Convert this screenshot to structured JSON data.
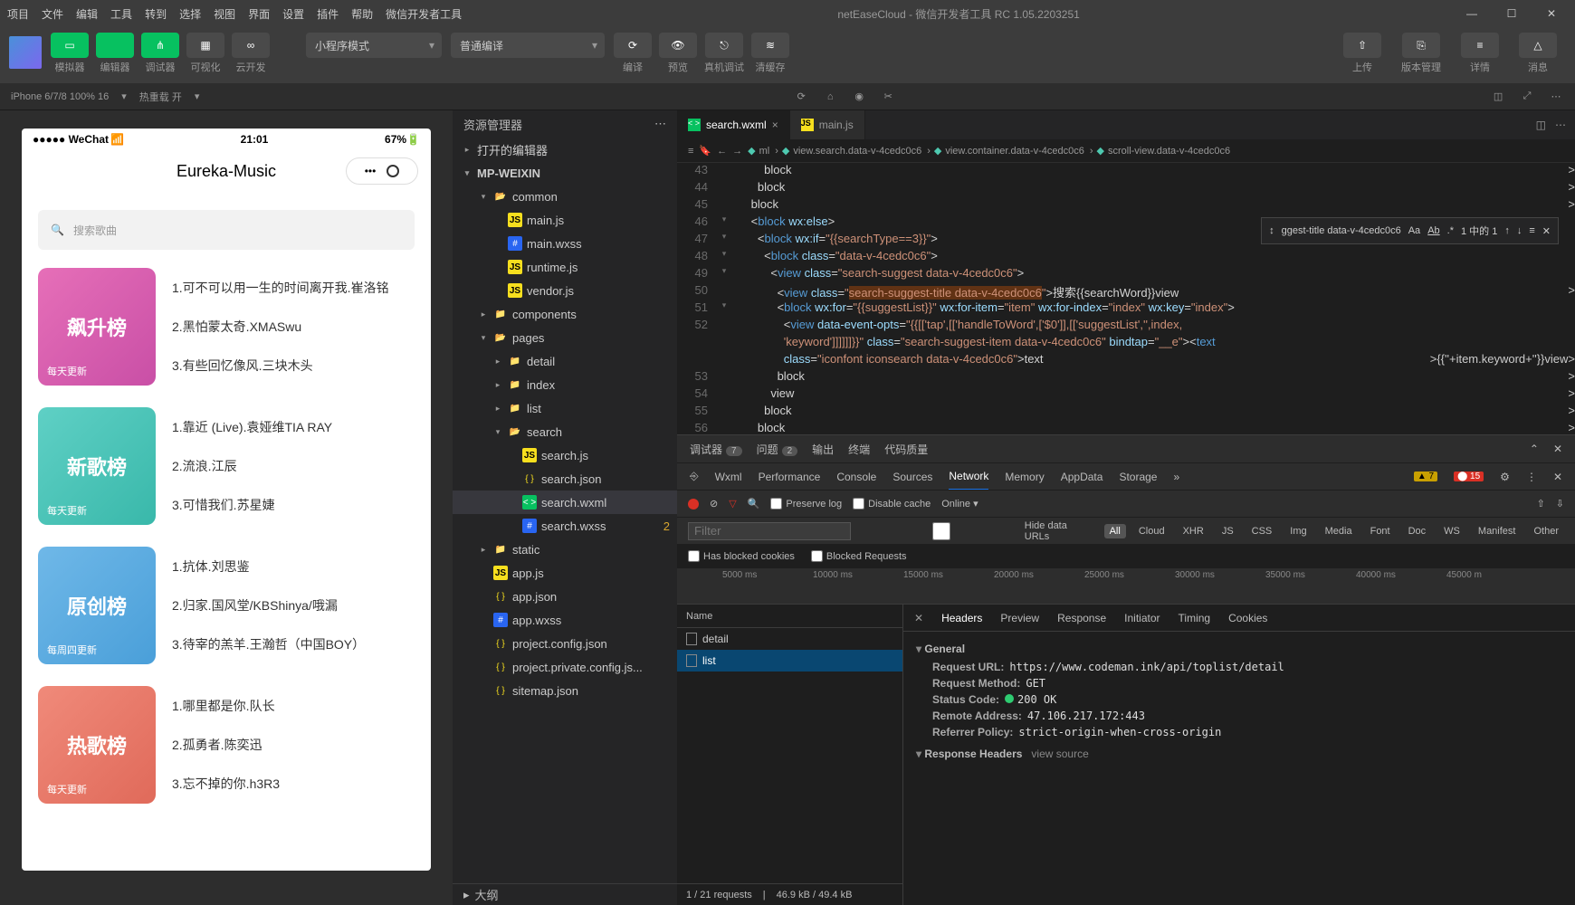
{
  "title": "netEaseCloud - 微信开发者工具 RC 1.05.2203251",
  "menus": [
    "项目",
    "文件",
    "编辑",
    "工具",
    "转到",
    "选择",
    "视图",
    "界面",
    "设置",
    "插件",
    "帮助",
    "微信开发者工具"
  ],
  "winbtns": {
    "min": "—",
    "max": "☐",
    "close": "✕"
  },
  "actionbar": {
    "groups": [
      {
        "icons": [
          {
            "cls": "green",
            "glyph": "▭"
          }
        ],
        "label": "模拟器"
      },
      {
        "icons": [
          {
            "cls": "green",
            "glyph": "</>"
          }
        ],
        "label": "编辑器"
      },
      {
        "icons": [
          {
            "cls": "green",
            "glyph": "⋔"
          }
        ],
        "label": "调试器"
      },
      {
        "icons": [
          {
            "cls": "dark",
            "glyph": "▦"
          }
        ],
        "label": "可视化"
      },
      {
        "icons": [
          {
            "cls": "dark",
            "glyph": "∞"
          }
        ],
        "label": "云开发"
      }
    ],
    "mode": "小程序模式",
    "compile": "普通编译",
    "midbtns": [
      {
        "glyph": "⟳",
        "label": "编译"
      },
      {
        "glyph": "👁",
        "label": "预览"
      },
      {
        "glyph": "⎋",
        "label": "真机调试"
      },
      {
        "glyph": "≋",
        "label": "清缓存"
      }
    ],
    "right": [
      {
        "glyph": "⇧",
        "label": "上传"
      },
      {
        "glyph": "⎘",
        "label": "版本管理"
      },
      {
        "glyph": "≡",
        "label": "详情"
      },
      {
        "glyph": "△",
        "label": "消息"
      }
    ]
  },
  "secondbar": {
    "device": "iPhone 6/7/8 100% 16",
    "hot": "热重载 开"
  },
  "phone": {
    "status": {
      "left": "●●●●● WeChat",
      "wifi": "📶",
      "time": "21:01",
      "battery": "67%"
    },
    "title": "Eureka-Music",
    "search_ph": "搜索歌曲",
    "ranks": [
      {
        "name": "飙升榜",
        "upd": "每天更新",
        "color": "linear-gradient(135deg,#e66fb8,#c94fa6)",
        "items": [
          "1.可不可以用一生的时间离开我.崔洛铭",
          "2.黑怕蒙太奇.XMASwu",
          "3.有些回忆像风.三块木头"
        ]
      },
      {
        "name": "新歌榜",
        "upd": "每天更新",
        "color": "linear-gradient(135deg,#5fd0c5,#39b8aa)",
        "items": [
          "1.靠近 (Live).袁娅维TIA RAY",
          "2.流浪.江辰",
          "3.可惜我们.苏星婕"
        ]
      },
      {
        "name": "原创榜",
        "upd": "每周四更新",
        "color": "linear-gradient(135deg,#6fb8e8,#4a9fd9)",
        "items": [
          "1.抗体.刘思鉴",
          "2.归家.国风堂/KBShinya/哦漏",
          "3.待宰的羔羊.王瀚哲（中国BOY）"
        ]
      },
      {
        "name": "热歌榜",
        "upd": "每天更新",
        "color": "linear-gradient(135deg,#f08a7a,#e06a5a)",
        "items": [
          "1.哪里都是你.队长",
          "2.孤勇者.陈奕迅",
          "3.忘不掉的你.h3R3"
        ]
      }
    ]
  },
  "explorer": {
    "title": "资源管理器",
    "sections": [
      "打开的编辑器"
    ],
    "root": "MP-WEIXIN",
    "outline": "大纲",
    "tree": [
      {
        "d": 1,
        "t": "folder-open",
        "n": "common",
        "a": "▾"
      },
      {
        "d": 2,
        "t": "js",
        "n": "main.js"
      },
      {
        "d": 2,
        "t": "css",
        "n": "main.wxss"
      },
      {
        "d": 2,
        "t": "js",
        "n": "runtime.js"
      },
      {
        "d": 2,
        "t": "js",
        "n": "vendor.js"
      },
      {
        "d": 1,
        "t": "folder",
        "n": "components",
        "a": "▸"
      },
      {
        "d": 1,
        "t": "folder-open-g",
        "n": "pages",
        "a": "▾"
      },
      {
        "d": 2,
        "t": "folder",
        "n": "detail",
        "a": "▸"
      },
      {
        "d": 2,
        "t": "folder",
        "n": "index",
        "a": "▸"
      },
      {
        "d": 2,
        "t": "folder",
        "n": "list",
        "a": "▸"
      },
      {
        "d": 2,
        "t": "folder-open-g",
        "n": "search",
        "a": "▾"
      },
      {
        "d": 3,
        "t": "js",
        "n": "search.js"
      },
      {
        "d": 3,
        "t": "json",
        "n": "search.json"
      },
      {
        "d": 3,
        "t": "wxml",
        "n": "search.wxml",
        "sel": true
      },
      {
        "d": 3,
        "t": "css",
        "n": "search.wxss",
        "mod": "2"
      },
      {
        "d": 1,
        "t": "folder",
        "n": "static",
        "a": "▸"
      },
      {
        "d": 1,
        "t": "js",
        "n": "app.js"
      },
      {
        "d": 1,
        "t": "json",
        "n": "app.json"
      },
      {
        "d": 1,
        "t": "css",
        "n": "app.wxss"
      },
      {
        "d": 1,
        "t": "json",
        "n": "project.config.json"
      },
      {
        "d": 1,
        "t": "json",
        "n": "project.private.config.js..."
      },
      {
        "d": 1,
        "t": "json",
        "n": "sitemap.json"
      }
    ]
  },
  "tabs": [
    {
      "icon": "wxml",
      "name": "search.wxml",
      "active": true,
      "close": "×"
    },
    {
      "icon": "js",
      "name": "main.js",
      "active": false
    }
  ],
  "breadcrumb": [
    "ml",
    "view.search.data-v-4cedc0c6",
    "view.container.data-v-4cedc0c6",
    "scroll-view.data-v-4cedc0c6"
  ],
  "find": {
    "text": "ggest-title data-v-4cedc0c6",
    "result": "1 中的 1"
  },
  "code": [
    {
      "n": 43,
      "g": "",
      "i": 5,
      "h": "</<tg>block</tg>>"
    },
    {
      "n": 44,
      "g": "",
      "i": 4,
      "h": "</<tg>block</tg>>"
    },
    {
      "n": 45,
      "g": "",
      "i": 3,
      "h": "</<tg>block</tg>>"
    },
    {
      "n": 46,
      "g": "▾",
      "i": 3,
      "h": "<<tg>block</tg> <attr>wx:else</attr>>"
    },
    {
      "n": 47,
      "g": "▾",
      "i": 4,
      "h": "<<tg>block</tg> <attr>wx:if</attr>=<str>\"{{searchType==3}}\"</str>>"
    },
    {
      "n": 48,
      "g": "▾",
      "i": 5,
      "h": "<<tg>block</tg> <attr>class</attr>=<str>\"data-v-4cedc0c6\"</str>>"
    },
    {
      "n": 49,
      "g": "▾",
      "i": 6,
      "h": "<<tg>view</tg> <attr>class</attr>=<str>\"search-suggest data-v-4cedc0c6\"</str>>"
    },
    {
      "n": 50,
      "g": "",
      "i": 7,
      "h": "<<tg>view</tg> <attr>class</attr>=<str>\"<hl>search-suggest-title data-v-4cedc0c6</hl>\"</str>>搜索{{searchWord}}</<tg>view</tg>>"
    },
    {
      "n": 51,
      "g": "▾",
      "i": 7,
      "h": "<<tg>block</tg> <attr>wx:for</attr>=<str>\"{{suggestList}}\"</str> <attr>wx:for-item</attr>=<str>\"item\"</str> <attr>wx:for-index</attr>=<str>\"index\"</str> <attr>wx:key</attr>=<str>\"index\"</str>>"
    },
    {
      "n": 52,
      "g": "",
      "i": 8,
      "h": "<<tg>view</tg> <attr>data-event-opts</attr>=<str>\"{{[['tap',[['handleToWord',['$0']],[['suggestList','',index,</str>"
    },
    {
      "n": "",
      "g": "",
      "i": 8,
      "h": "<str>'keyword']]]]]]}}\"</str> <attr>class</attr>=<str>\"search-suggest-item data-v-4cedc0c6\"</str> <attr>bindtap</attr>=<str>\"__e\"</str>><<tg>text</tg>"
    },
    {
      "n": "",
      "g": "",
      "i": 8,
      "h": "<attr>class</attr>=<str>\"iconfont iconsearch data-v-4cedc0c6\"</str>></<tg>text</tg>>{{''+item.keyword+''}}</<tg>view</tg>>"
    },
    {
      "n": 53,
      "g": "",
      "i": 7,
      "h": "</<tg>block</tg>>"
    },
    {
      "n": 54,
      "g": "",
      "i": 6,
      "h": "</<tg>view</tg>>"
    },
    {
      "n": 55,
      "g": "",
      "i": 5,
      "h": "</<tg>block</tg>>"
    },
    {
      "n": 56,
      "g": "",
      "i": 4,
      "h": "</<tg>block</tg>>"
    }
  ],
  "dbg": {
    "tabs": [
      {
        "n": "调试器",
        "b": "7"
      },
      {
        "n": "问题",
        "b": "2"
      },
      {
        "n": "输出"
      },
      {
        "n": "终端"
      },
      {
        "n": "代码质量"
      }
    ],
    "dev": [
      "Wxml",
      "Performance",
      "Console",
      "Sources",
      "Network",
      "Memory",
      "AppData",
      "Storage"
    ],
    "dev_active": "Network",
    "warn": "7",
    "err": "15",
    "netbar": {
      "preserve": "Preserve log",
      "disable": "Disable cache",
      "online": "Online"
    },
    "filter": {
      "ph": "Filter",
      "hide": "Hide data URLs",
      "types": [
        "All",
        "Cloud",
        "XHR",
        "JS",
        "CSS",
        "Img",
        "Media",
        "Font",
        "Doc",
        "WS",
        "Manifest",
        "Other"
      ],
      "active": "All"
    },
    "blocked": {
      "a": "Has blocked cookies",
      "b": "Blocked Requests"
    },
    "ticks": [
      "5000 ms",
      "10000 ms",
      "15000 ms",
      "20000 ms",
      "25000 ms",
      "30000 ms",
      "35000 ms",
      "40000 ms",
      "45000 m"
    ],
    "reqs": {
      "hdr": "Name",
      "rows": [
        "detail",
        "list"
      ],
      "sel": "list",
      "foot": [
        "1 / 21 requests",
        "46.9 kB / 49.4 kB"
      ]
    },
    "detail": {
      "tabs": [
        "Headers",
        "Preview",
        "Response",
        "Initiator",
        "Timing",
        "Cookies"
      ],
      "active": "Headers",
      "general_title": "General",
      "general": [
        {
          "k": "Request URL:",
          "v": "https://www.codeman.ink/api/toplist/detail"
        },
        {
          "k": "Request Method:",
          "v": "GET"
        },
        {
          "k": "Status Code:",
          "v": "200 OK",
          "status": true
        },
        {
          "k": "Remote Address:",
          "v": "47.106.217.172:443"
        },
        {
          "k": "Referrer Policy:",
          "v": "strict-origin-when-cross-origin"
        }
      ],
      "resp_title": "Response Headers",
      "view_source": "view source"
    }
  }
}
